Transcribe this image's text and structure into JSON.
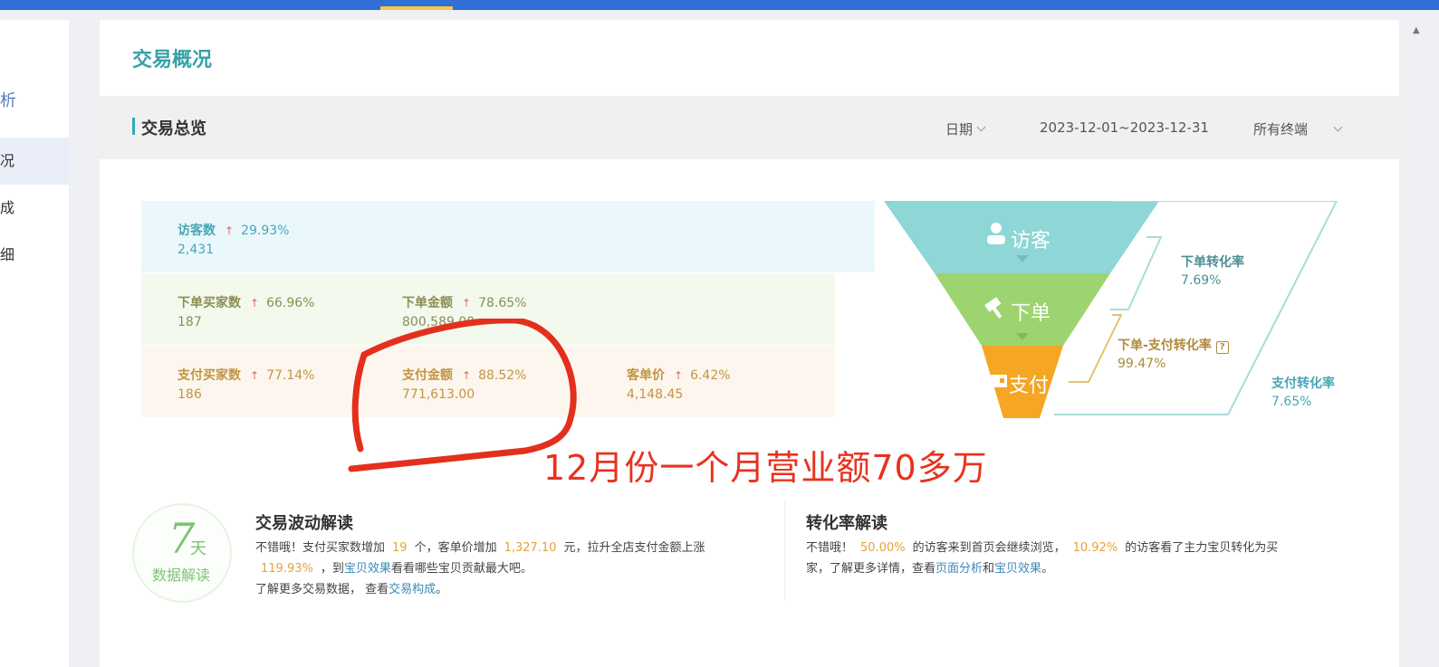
{
  "sidebar": {
    "items": [
      {
        "label": "析"
      },
      {
        "label": "况"
      },
      {
        "label": "成"
      },
      {
        "label": "细"
      }
    ]
  },
  "header": {
    "title": "交易概况"
  },
  "section": {
    "title": "交易总览",
    "date_label": "日期",
    "date_range": "2023-12-01~2023-12-31",
    "terminal": "所有终端"
  },
  "metrics": {
    "visitors": {
      "label": "访客数",
      "change": "29.93%",
      "value": "2,431"
    },
    "order_buyers": {
      "label": "下单买家数",
      "change": "66.96%",
      "value": "187"
    },
    "order_amount": {
      "label": "下单金额",
      "change": "78.65%",
      "value": "800,589.00"
    },
    "pay_buyers": {
      "label": "支付买家数",
      "change": "77.14%",
      "value": "186"
    },
    "pay_amount": {
      "label": "支付金额",
      "change": "88.52%",
      "value": "771,613.00"
    },
    "avg_price": {
      "label": "客单价",
      "change": "6.42%",
      "value": "4,148.45"
    }
  },
  "funnel": {
    "visitor_label": "访客",
    "order_label": "下单",
    "pay_label": "支付",
    "order_rate_label": "下单转化率",
    "order_rate_value": "7.69%",
    "order_pay_rate_label": "下单-支付转化率",
    "order_pay_rate_value": "99.47%",
    "pay_rate_label": "支付转化率",
    "pay_rate_value": "7.65%",
    "colors": {
      "visitor": "#8fd6d6",
      "order": "#9dd46f",
      "pay": "#f5a623"
    }
  },
  "annotation": {
    "text": "12月份一个月营业额70多万"
  },
  "badge": {
    "num": "7",
    "unit": "天",
    "text": "数据解读"
  },
  "trade": {
    "title": "交易波动解读",
    "p1a": "不错哦！支付买家数增加",
    "h1": "19",
    "p1b": "个，客单价增加",
    "h2": "1,327.10",
    "p1c": "元，拉升全店支付金额上涨",
    "h3": "119.93%",
    "p2a": "，到",
    "link1": "宝贝效果",
    "p2b": "看看哪些宝贝贡献最大吧。",
    "p3a": "了解更多交易数据，  查看",
    "link2": "交易构成",
    "p3b": "。"
  },
  "conversion": {
    "title": "转化率解读",
    "p1a": "不错哦！",
    "h1": "50.00%",
    "p1b": "的访客来到首页会继续浏览，",
    "h2": "10.92%",
    "p1c": "的访客看了主力宝贝转化为买",
    "p2a": "家，了解更多详情，查看",
    "link1": "页面分析",
    "p2b": "和",
    "link2": "宝贝效果",
    "p2c": "。"
  }
}
